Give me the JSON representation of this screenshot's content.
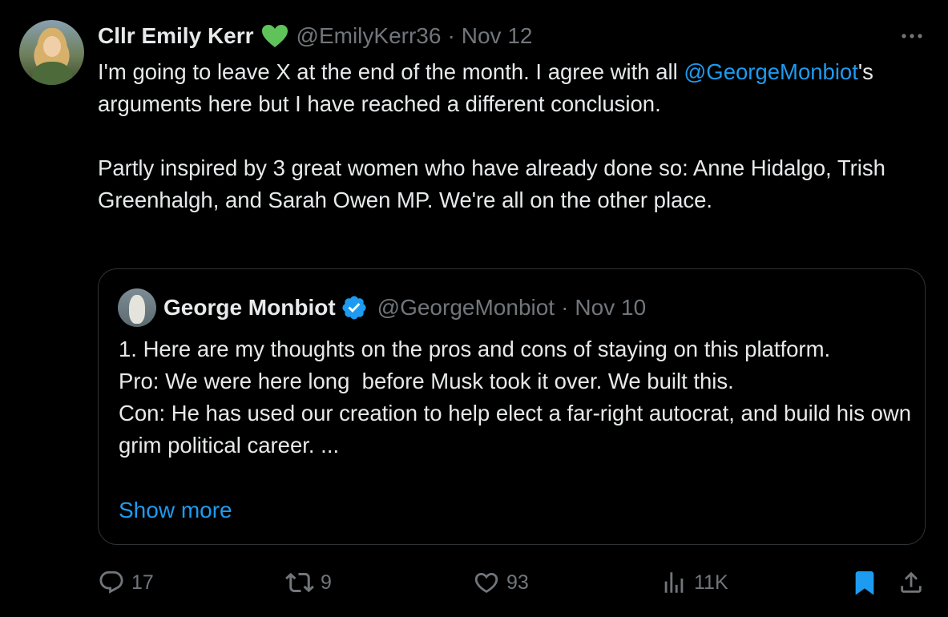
{
  "tweet": {
    "author_name": "Cllr Emily Kerr",
    "badge_icon": "green-heart-icon",
    "handle": "@EmilyKerr36",
    "separator": "·",
    "date": "Nov 12",
    "text_part1": "I'm going to leave X at the end of the month. I agree with all ",
    "mention": "@GeorgeMonbiot",
    "text_part2": "'s arguments here but I have reached a different conclusion.\n\nPartly inspired by 3 great women who have already done so: Anne Hidalgo, Trish Greenhalgh, and Sarah Owen MP. We're all on the other place.",
    "more_icon": "more-options-icon"
  },
  "quoted_tweet": {
    "author_name": "George Monbiot",
    "badge_icon": "verified-badge-icon",
    "handle": "@GeorgeMonbiot",
    "separator": "·",
    "date": "Nov 10",
    "text": "1. Here are my thoughts on the pros and cons of staying on this platform.\nPro: We were here long  before Musk took it over. We built this.\nCon: He has used our creation to help elect a far-right autocrat, and build his own grim political career. ...",
    "show_more_label": "Show more"
  },
  "actions": {
    "replies": "17",
    "reposts": "9",
    "likes": "93",
    "views": "11K"
  },
  "colors": {
    "background": "#000000",
    "text": "#e7e9ea",
    "muted": "#71767b",
    "link": "#1d9bf0",
    "heart": "#5fc35a",
    "border": "#2f3336"
  }
}
